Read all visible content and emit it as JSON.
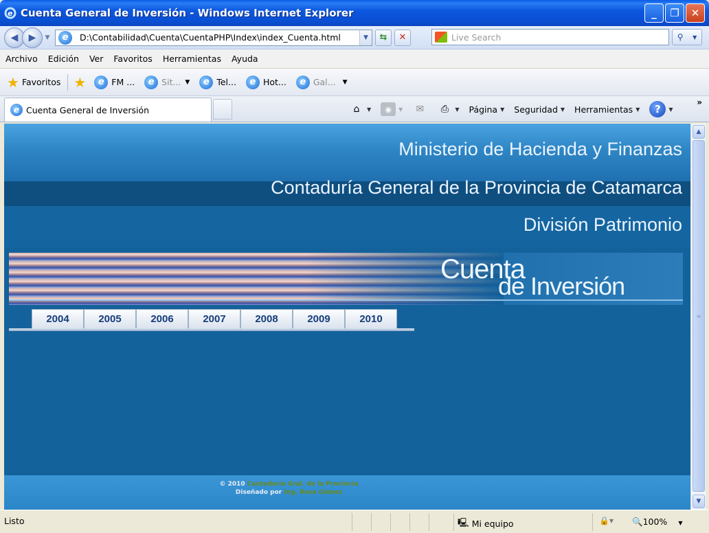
{
  "window": {
    "title": "Cuenta General de Inversión - Windows Internet Explorer",
    "minimize": "_",
    "restore": "❐",
    "close": "✕"
  },
  "address_bar": {
    "url": "D:\\Contabilidad\\Cuenta\\CuentaPHP\\Index\\index_Cuenta.html",
    "search_placeholder": "Live Search"
  },
  "menu": [
    "Archivo",
    "Edición",
    "Ver",
    "Favoritos",
    "Herramientas",
    "Ayuda"
  ],
  "favorites_bar": {
    "favorites_label": "Favoritos",
    "items": [
      "FM ...",
      "Sit...",
      "Tel...",
      "Hot...",
      "Gal..."
    ]
  },
  "tab": {
    "title": "Cuenta General de Inversión"
  },
  "command_bar": {
    "page": "Página",
    "security": "Seguridad",
    "tools": "Herramientas",
    "more": "»"
  },
  "page": {
    "line1": "Ministerio de Hacienda y Finanzas",
    "line2": "Contaduría General de la Provincia de Catamarca",
    "line3": "División Patrimonio",
    "logo_top": "Cuenta",
    "logo_bottom": "de Inversión",
    "years": [
      "2004",
      "2005",
      "2006",
      "2007",
      "2008",
      "2009",
      "2010"
    ],
    "footer": {
      "copyright": "© 2010",
      "org": "Contaduría Gral. de la Provincia",
      "designed_by": "Diseñado por",
      "designer": "Ing. Rosa Gómez"
    }
  },
  "status_bar": {
    "status": "Listo",
    "zone": "Mi equipo",
    "zoom": "100%"
  }
}
